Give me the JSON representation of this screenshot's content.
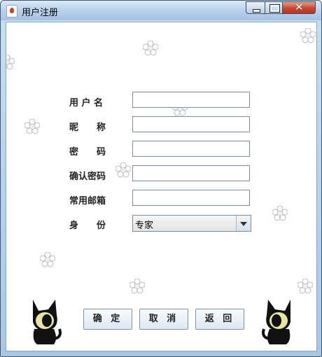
{
  "window": {
    "title": "用户注册",
    "close_glyph": "✕"
  },
  "form": {
    "fields": [
      {
        "label": "用 户 名",
        "value": ""
      },
      {
        "label": "昵　　称",
        "value": ""
      },
      {
        "label": "密　　码",
        "value": ""
      },
      {
        "label": "确认密码",
        "value": ""
      },
      {
        "label": "常用邮箱",
        "value": ""
      }
    ],
    "role": {
      "label": "身　　份",
      "selected": "专家"
    }
  },
  "buttons": {
    "confirm": "确 定",
    "cancel": "取 消",
    "back": "返 回"
  },
  "decor": {
    "flower_icon": "flower-icon",
    "cat_icon": "black-cat-icon",
    "flower_color": "#ffffff",
    "cat_color": "#111111"
  }
}
